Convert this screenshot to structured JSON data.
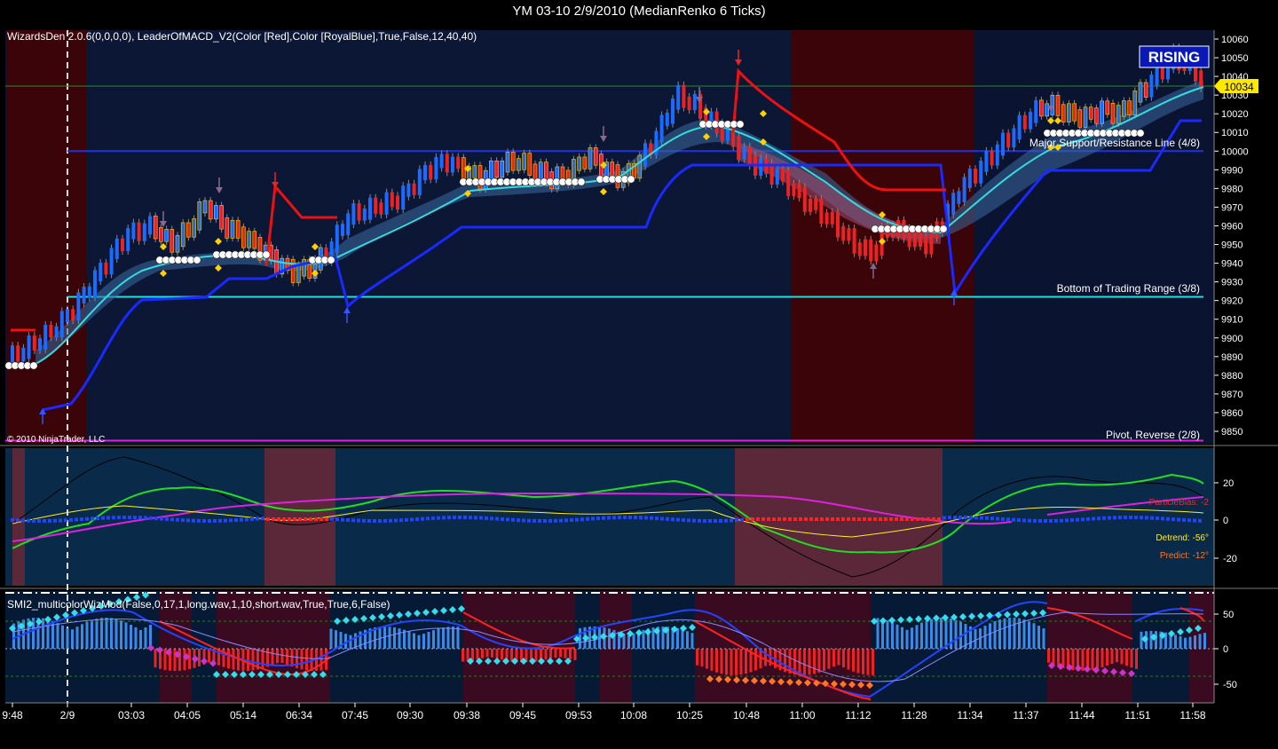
{
  "window": {
    "title": "YM 03-10  2/9/2010 (MedianRenko 6 Ticks)"
  },
  "price_panel": {
    "indicator_label": "WizardsDen 2.0.6(0,0,0,0),  LeaderOfMACD_V2(Color [Red],Color [RoyalBlue],True,False,12,40,40)",
    "copyright": "© 2010 NinjaTrader, LLC",
    "badge": "RISING",
    "last_price": "10034",
    "lines": [
      {
        "label": "Major Support/Resistance Line (4/8)",
        "value": 10000,
        "color": "#2233dd"
      },
      {
        "label": "Bottom of Trading Range (3/8)",
        "value": 9922,
        "color": "#22dddd"
      },
      {
        "label": "Pivot, Reverse (2/8)",
        "value": 9845,
        "color": "#dd22dd"
      }
    ],
    "y_ticks": [
      "10060",
      "10050",
      "10040",
      "10030",
      "10020",
      "10010",
      "10000",
      "9990",
      "9980",
      "9970",
      "9960",
      "9950",
      "9940",
      "9930",
      "9920",
      "9910",
      "9900",
      "9890",
      "9880",
      "9870",
      "9860",
      "9850"
    ]
  },
  "osc_panel": {
    "labels": {
      "particle": "ParticleBias: -2",
      "detrend": "Detrend: -56°",
      "predict": "Predict: -12°"
    },
    "y_ticks": [
      "20",
      "0",
      "-20"
    ]
  },
  "smi_panel": {
    "label": "SMI2_multicolorWizMod(False,0,17,1,long.wav,1,10,short.wav,True,True,6,False)",
    "y_ticks": [
      "50",
      "0",
      "-50"
    ]
  },
  "x_axis": {
    "labels": [
      "9:48",
      "2/9",
      "03:03",
      "04:05",
      "05:14",
      "06:34",
      "07:45",
      "09:30",
      "09:38",
      "09:45",
      "09:53",
      "10:08",
      "10:25",
      "10:48",
      "11:00",
      "11:12",
      "11:28",
      "11:34",
      "11:37",
      "11:44",
      "11:51",
      "11:58"
    ]
  },
  "chart_data": {
    "type": "line",
    "title": "YM 03-10  2/9/2010 (MedianRenko 6 Ticks)",
    "x": [
      "9:48",
      "2/9",
      "03:03",
      "04:05",
      "05:14",
      "06:34",
      "07:45",
      "09:30",
      "09:38",
      "09:45",
      "09:53",
      "10:08",
      "10:25",
      "10:48",
      "11:00",
      "11:12",
      "11:28",
      "11:34",
      "11:37",
      "11:44",
      "11:51",
      "11:58"
    ],
    "ylim": [
      9845,
      10063
    ],
    "series": [
      {
        "name": "Price",
        "values": [
          9888,
          9905,
          9955,
          9945,
          9945,
          9930,
          9958,
          9985,
          9985,
          9988,
          9985,
          10000,
          10030,
          9990,
          9975,
          9950,
          9955,
          9965,
          10000,
          10015,
          10020,
          10040
        ]
      }
    ],
    "horizontal_lines": [
      {
        "label": "Major Support/Resistance Line (4/8)",
        "value": 10000
      },
      {
        "label": "Bottom of Trading Range (3/8)",
        "value": 9922
      },
      {
        "label": "Pivot, Reverse (2/8)",
        "value": 9845
      }
    ]
  }
}
